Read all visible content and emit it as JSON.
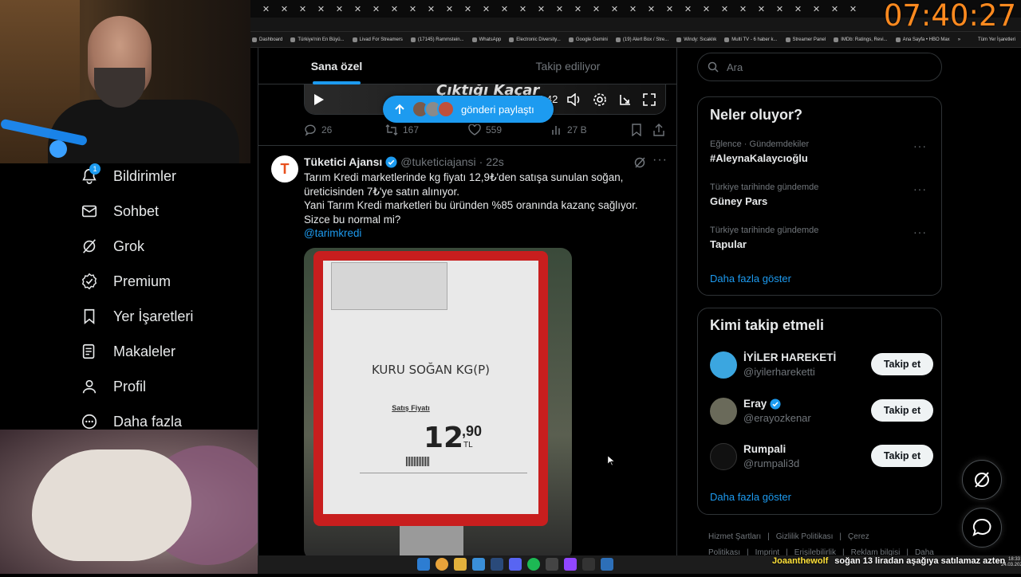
{
  "browser": {
    "clock": "07:40:27",
    "bookmarks": [
      "Dashboard",
      "Türkiye'nin En Büyü...",
      "Livad For Streamers",
      "(17145) Rammstein...",
      "WhatsApp",
      "Electronic Diversity...",
      "Google Gemini",
      "(19) Alert Box / Stre...",
      "Windy: Sıcaklık",
      "Multi TV - 6 haber k...",
      "Streamer Panel",
      "IMDb: Ratings, Revi...",
      "Ana Sayfa • HBO Max"
    ],
    "bookmarks_overflow": "»",
    "bookmarks_all": "Tüm Yer İşaretleri"
  },
  "nav": {
    "notifications_badge": "1",
    "items": [
      {
        "label": "Bildirimler",
        "icon": "bell-icon"
      },
      {
        "label": "Sohbet",
        "icon": "mail-icon"
      },
      {
        "label": "Grok",
        "icon": "grok-icon"
      },
      {
        "label": "Premium",
        "icon": "verified-badge-icon"
      },
      {
        "label": "Yer İşaretleri",
        "icon": "bookmark-icon"
      },
      {
        "label": "Makaleler",
        "icon": "article-icon"
      },
      {
        "label": "Profil",
        "icon": "person-icon"
      },
      {
        "label": "Daha fazla",
        "icon": "more-circle-icon"
      }
    ]
  },
  "main": {
    "tabs": [
      "Sana özel",
      "Takip ediliyor"
    ],
    "prev_tweet": {
      "video_title": "Çıktığı Kaçar",
      "video_time": "4:42",
      "replies": "26",
      "reposts": "167",
      "likes": "559",
      "views": "27 B"
    },
    "share_pill": "gönderi paylaştı",
    "tweet": {
      "avatar_letter": "T",
      "name": "Tüketici Ajansı",
      "handle": "@tuketiciajansi",
      "time": "· 22s",
      "line1": "Tarım Kredi marketlerinde kg fiyatı 12,9₺'den satışa sunulan soğan,",
      "line2": "üreticisinden 7₺'ye satın alınıyor.",
      "line3": "Yani Tarım Kredi marketleri bu üründen %85 oranında kazanç sağlıyor.",
      "line4": "Sizce bu normal mi?",
      "mention": "@tarimkredi",
      "image": {
        "product": "KURU SOĞAN KG(P)",
        "price_label": "Satış Fiyatı",
        "price_int": "12",
        "price_dec": ",90",
        "currency": "TL"
      }
    }
  },
  "sidebar": {
    "search_placeholder": "Ara",
    "trends_title": "Neler oluyor?",
    "trends": [
      {
        "context": "Eğlence · Gündemdekiler",
        "topic": "#AleynaKalaycıoğlu"
      },
      {
        "context": "Türkiye tarihinde gündemde",
        "topic": "Güney Pars"
      },
      {
        "context": "Türkiye tarihinde gündemde",
        "topic": "Tapular"
      }
    ],
    "show_more": "Daha fazla göster",
    "follow_title": "Kimi takip etmeli",
    "follow": [
      {
        "name": "İYİLER HAREKETİ",
        "handle": "@iyilerhareketti",
        "button": "Takip et",
        "verified": false,
        "avatar_color": "#3ba6e0"
      },
      {
        "name": "Eray",
        "handle": "@erayozkenar",
        "button": "Takip et",
        "verified": true,
        "avatar_color": "#6a6a5a"
      },
      {
        "name": "Rumpali",
        "handle": "@rumpali3d",
        "button": "Takip et",
        "verified": false,
        "avatar_color": "#111111"
      }
    ],
    "footer_links": [
      "Hizmet Şartları",
      "|",
      "Gizlilik Politikası",
      "|",
      "Çerez Politikası",
      "|",
      "Imprint",
      "|",
      "Erişilebilirlik",
      "|",
      "Reklam bilgisi",
      "|",
      "Daha fazla ···"
    ]
  },
  "stream": {
    "chat_user": "Joaanthewolf",
    "chat_msg": "soğan 13 liradan aşağıya satılamaz azten",
    "tray_time": "18:33",
    "tray_date": "24.03.2026"
  },
  "colors": {
    "accent": "#1d9bf0",
    "clock": "#ff8a1f",
    "price_tag": "#c81e1e"
  }
}
